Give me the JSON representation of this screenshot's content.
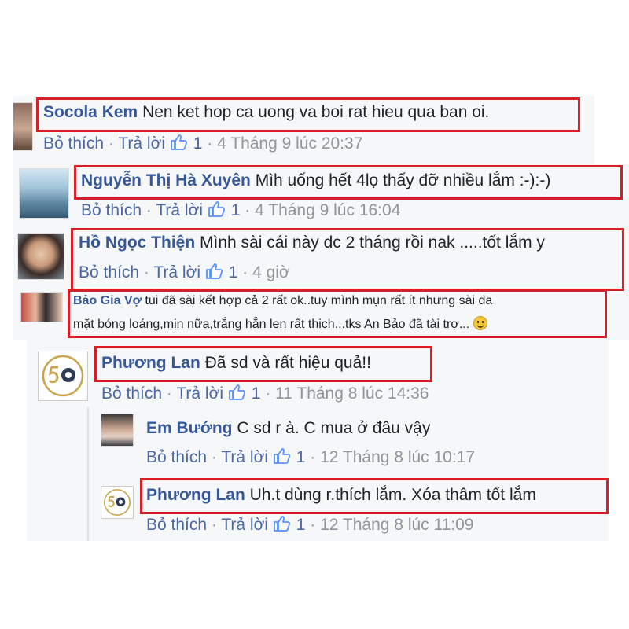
{
  "labels": {
    "like": "Bỏ thích",
    "reply": "Trả lời",
    "dot": "·"
  },
  "comments": [
    {
      "author": "Socola Kem",
      "text": "Nen ket hop ca uong va boi rat hieu qua ban oi.",
      "likes": "1",
      "time": "4 Tháng 9 lúc 20:37",
      "avatar_icon": "profile-photo"
    },
    {
      "author": "Nguyễn Thị Hà Xuyên",
      "text": "Mìh uống hết 4lọ thấy đỡ nhiều lắm :-):-)",
      "likes": "1",
      "time": "4 Tháng 9 lúc 16:04",
      "avatar_icon": "profile-photo"
    },
    {
      "author": "Hồ Ngọc Thiện",
      "text": "Mình sài cái này dc 2 tháng rồi nak .....tốt lắm y",
      "likes": "1",
      "time": "4 giờ",
      "avatar_icon": "profile-photo"
    },
    {
      "author": "Bảo Gia Vợ",
      "text_line1": "tui đã sài kết hợp cả 2 rất ok..tuy mình mụn rất ít nhưng sài da",
      "text_line2": "mặt bóng loáng,mịn nữa,trắng hẳn len rất thich...tks An Bảo đã tài trợ...",
      "emoji": "smile-emoji",
      "avatar_icon": "profile-photo"
    },
    {
      "author": "Phương Lan",
      "text": "Đã sd và rất hiệu quả!!",
      "likes": "1",
      "time": "11 Tháng 8 lúc 14:36",
      "avatar_icon": "50-logo"
    },
    {
      "author": "Em Bướng",
      "text": "C sd r à. C mua ở đâu vậy",
      "likes": "1",
      "time": "12 Tháng 8 lúc 10:17",
      "avatar_icon": "profile-photo"
    },
    {
      "author": "Phương Lan",
      "text": "Uh.t dùng r.thích lắm. Xóa thâm tốt lắm",
      "likes": "1",
      "time": "12 Tháng 8 lúc 11:09",
      "avatar_icon": "50-logo"
    }
  ],
  "colors": {
    "name": "#365899",
    "meta": "#90949c",
    "highlight_border": "#d81e27",
    "panel": "#f6f7f9"
  }
}
